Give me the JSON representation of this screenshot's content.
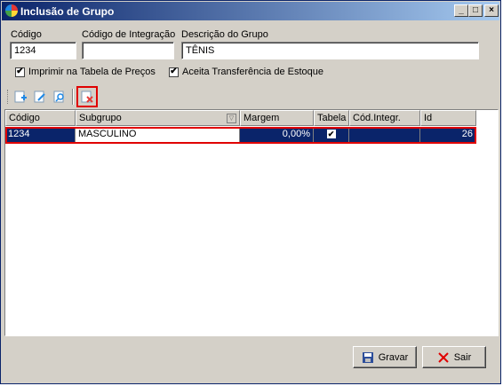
{
  "window": {
    "title": "Inclusão de Grupo"
  },
  "title_buttons": {
    "minimize": "_",
    "maximize": "□",
    "close": "×"
  },
  "form": {
    "codigo_label": "Código",
    "codigo_value": "1234",
    "integracao_label": "Código de Integração",
    "integracao_value": "",
    "descricao_label": "Descrição do Grupo",
    "descricao_value": "TÊNIS",
    "imprimir_label": "Imprimir na Tabela de Preços",
    "imprimir_checked": true,
    "aceita_label": "Aceita Transferência de Estoque",
    "aceita_checked": true
  },
  "toolbar": {
    "tools": [
      {
        "icon": "add-document-icon"
      },
      {
        "icon": "edit-document-icon"
      },
      {
        "icon": "search-document-icon"
      },
      {
        "icon": "delete-document-icon",
        "highlighted": true
      }
    ]
  },
  "grid": {
    "columns": [
      "Código",
      "Subgrupo",
      "Margem",
      "Tabela",
      "Cód.Integr.",
      "Id"
    ],
    "rows": [
      {
        "codigo": "1234",
        "subgrupo": "MASCULINO",
        "margem": "0,00%",
        "tabela": "✔",
        "cod_integr": "",
        "id": "26"
      }
    ]
  },
  "buttons": {
    "gravar": "Gravar",
    "sair": "Sair"
  },
  "colors": {
    "title_start": "#0a246a",
    "title_end": "#a6caf0",
    "selection": "#0a246a",
    "highlight": "#e00000"
  }
}
